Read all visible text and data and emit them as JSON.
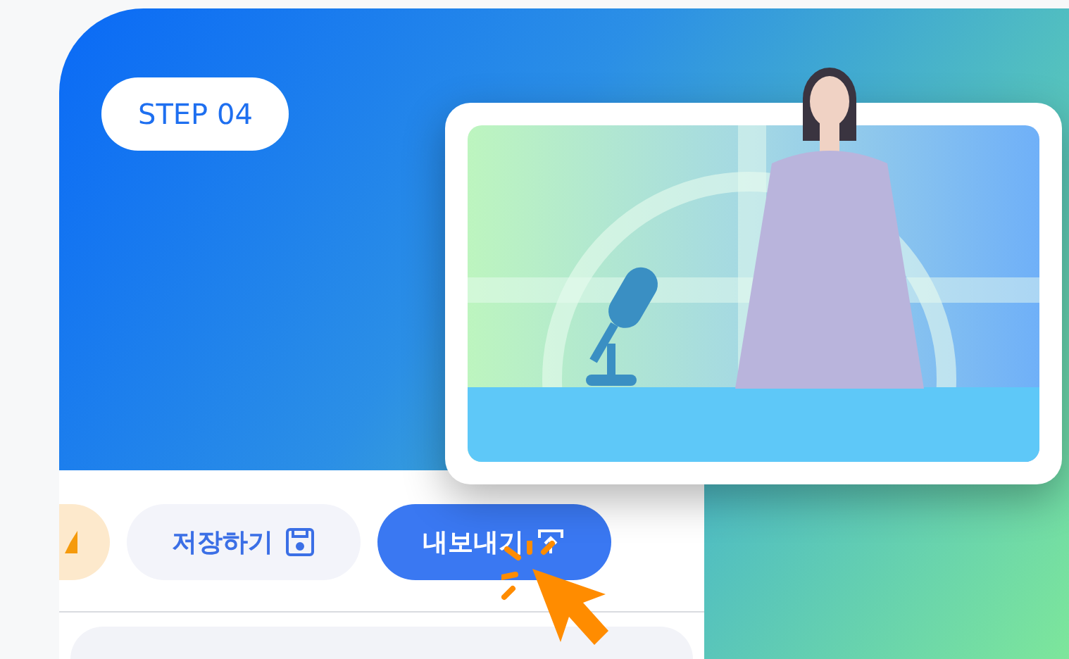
{
  "step_badge": "STEP 04",
  "toolbar": {
    "buttons": [
      {
        "kind": "accent"
      },
      {
        "kind": "secondary",
        "label": "저장하기"
      },
      {
        "kind": "primary",
        "label": "내보내기"
      }
    ]
  }
}
